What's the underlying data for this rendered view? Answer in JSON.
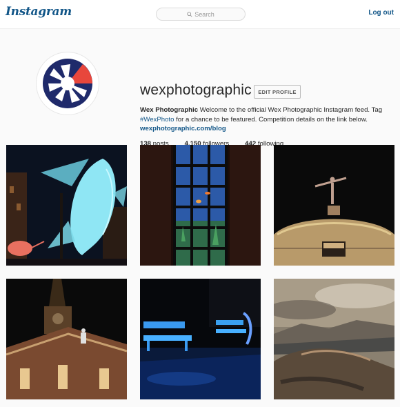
{
  "header": {
    "logo_text": "Instagram",
    "search_placeholder": "Search",
    "logout_label": "Log out"
  },
  "profile": {
    "username": "wexphotographic",
    "edit_button_label": "EDIT PROFILE",
    "bio_name": "Wex Photographic",
    "bio_text_1": " Welcome to the official Wex Photographic Instagram feed. Tag ",
    "bio_hashtag": "#WexPhoto",
    "bio_text_2": " for a chance to be featured. Competition details on the link below.",
    "website": "wexphotographic.com/blog",
    "stats": {
      "posts_count": "138",
      "posts_label": " posts",
      "followers_count": "4,150",
      "followers_label": " followers",
      "following_count": "442",
      "following_label": " following"
    }
  },
  "colors": {
    "brand_blue": "#125688",
    "logo_navy": "#1f2a6b",
    "logo_red": "#e8473c"
  },
  "icons": {
    "search": "search-icon",
    "avatar": "aperture-logo"
  }
}
